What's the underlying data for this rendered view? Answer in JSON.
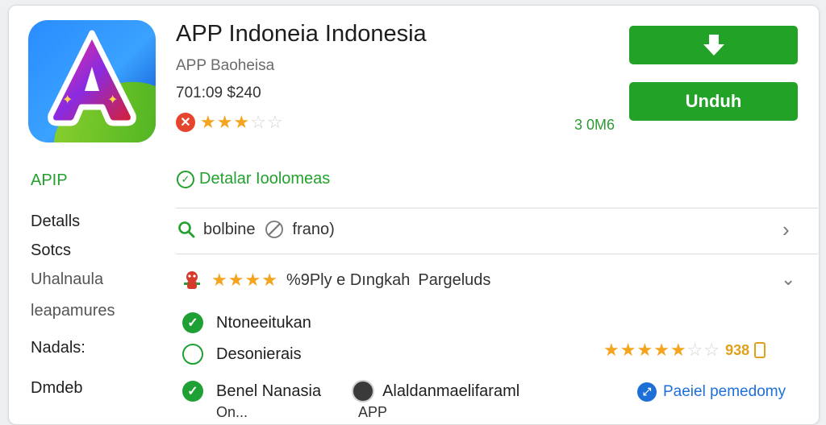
{
  "app": {
    "title": "APP Indoneia Indonesia",
    "developer": "APP Baoheisa",
    "meta": "701:09 $240",
    "rating_stars": 3,
    "rating_max": 5,
    "size": "3 0M6",
    "icon_letter": "A"
  },
  "buttons": {
    "download_icon": "download-arrow-icon",
    "unduh_label": "Unduh"
  },
  "sidebar": {
    "items": [
      {
        "label": "APIP"
      },
      {
        "label": "Detalls"
      },
      {
        "label": "Sotcs"
      },
      {
        "label": "Uhalnaula"
      },
      {
        "label": "leapamures"
      },
      {
        "label": "Nadals:"
      },
      {
        "label": "Dmdeb"
      }
    ]
  },
  "detail_link": {
    "label": "Detalar Ioolomeas"
  },
  "search_row": {
    "left": "bolbine",
    "right": "frano)"
  },
  "review_row": {
    "stars": 4,
    "text1": "%9Ply e Dıngkah",
    "text2": "Pargeluds"
  },
  "features": [
    {
      "label": "Ntoneeitukan",
      "checked": true
    },
    {
      "label": "Desonierais",
      "checked": false
    },
    {
      "label": "Benel Nanasia",
      "checked": true,
      "extra": "Alaldanmaelifaraml"
    }
  ],
  "right_rating": {
    "stars": 5,
    "max": 7,
    "value": "938"
  },
  "partial_link": {
    "label": "Paeiel pemedomy"
  },
  "cutoff": {
    "left": "On...",
    "right": "APP"
  },
  "colors": {
    "accent_green": "#22a227",
    "star": "#f4a41f",
    "link_blue": "#1d6fd8",
    "error_red": "#e5452c"
  }
}
